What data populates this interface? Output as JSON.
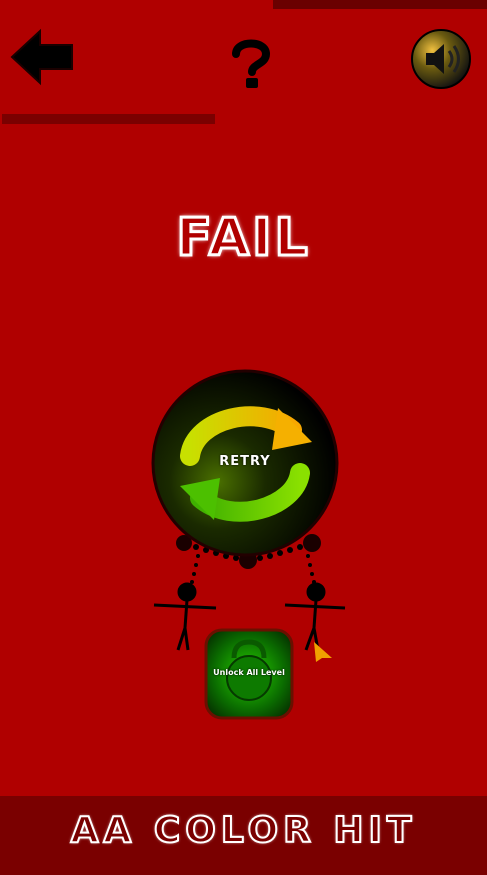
{
  "header": {
    "back_icon": "back-arrow-icon",
    "help_icon": "question-mark-icon",
    "sound_icon": "speaker-icon"
  },
  "result": {
    "title": "FAIL"
  },
  "retry": {
    "label": "RETRY",
    "icon": "refresh-arrows-icon"
  },
  "unlock": {
    "label": "Unlock All Level"
  },
  "footer": {
    "title": "AA COLOR HIT"
  },
  "colors": {
    "background": "#b00000",
    "dark_red": "#7a0000",
    "retry_green": "#7cd200",
    "retry_yellow": "#f5c400",
    "unlock_green": "#1fb800"
  }
}
